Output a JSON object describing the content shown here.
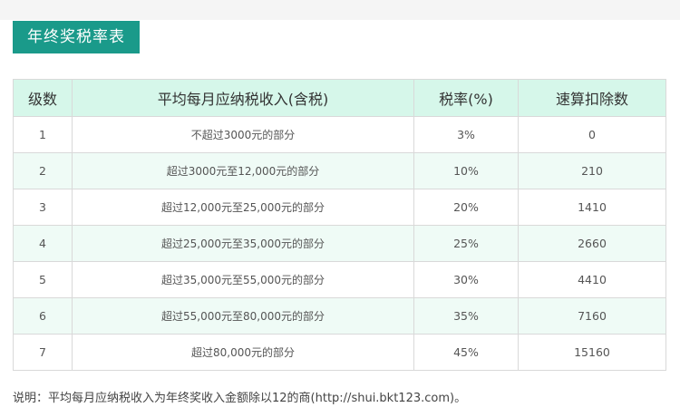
{
  "title": "年终奖税率表",
  "table": {
    "headers": [
      "级数",
      "平均每月应纳税收入(含税)",
      "税率(%)",
      "速算扣除数"
    ],
    "rows": [
      [
        "1",
        "不超过3000元的部分",
        "3%",
        "0"
      ],
      [
        "2",
        "超过3000元至12,000元的部分",
        "10%",
        "210"
      ],
      [
        "3",
        "超过12,000元至25,000元的部分",
        "20%",
        "1410"
      ],
      [
        "4",
        "超过25,000元至35,000元的部分",
        "25%",
        "2660"
      ],
      [
        "5",
        "超过35,000元至55,000元的部分",
        "30%",
        "4410"
      ],
      [
        "6",
        "超过55,000元至80,000元的部分",
        "35%",
        "7160"
      ],
      [
        "7",
        "超过80,000元的部分",
        "45%",
        "15160"
      ]
    ]
  },
  "note": "说明：平均每月应纳税收入为年终奖收入金额除以12的商(http://shui.bkt123.com)。"
}
